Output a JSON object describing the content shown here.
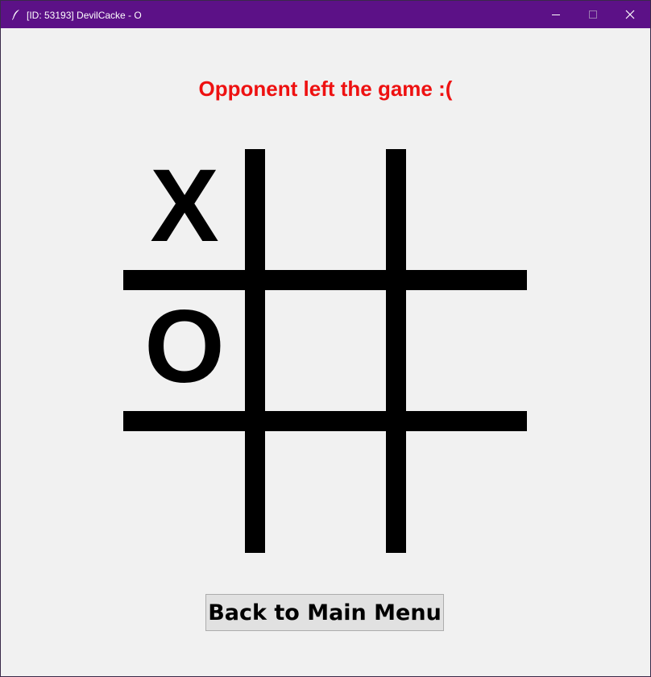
{
  "window": {
    "title": "[ID: 53193] DevilCacke - O",
    "titlebar_color": "#5c1187",
    "app_icon": "feather-icon",
    "controls": {
      "minimize_icon": "minimize-icon",
      "maximize_icon": "maximize-icon",
      "close_icon": "close-icon"
    }
  },
  "game": {
    "status_message": "Opponent left the game :(",
    "status_color": "#ee1111",
    "board": {
      "cells": [
        "X",
        "",
        "",
        "O",
        "",
        "",
        "",
        "",
        ""
      ]
    },
    "back_button_label": "Back to Main Menu"
  }
}
